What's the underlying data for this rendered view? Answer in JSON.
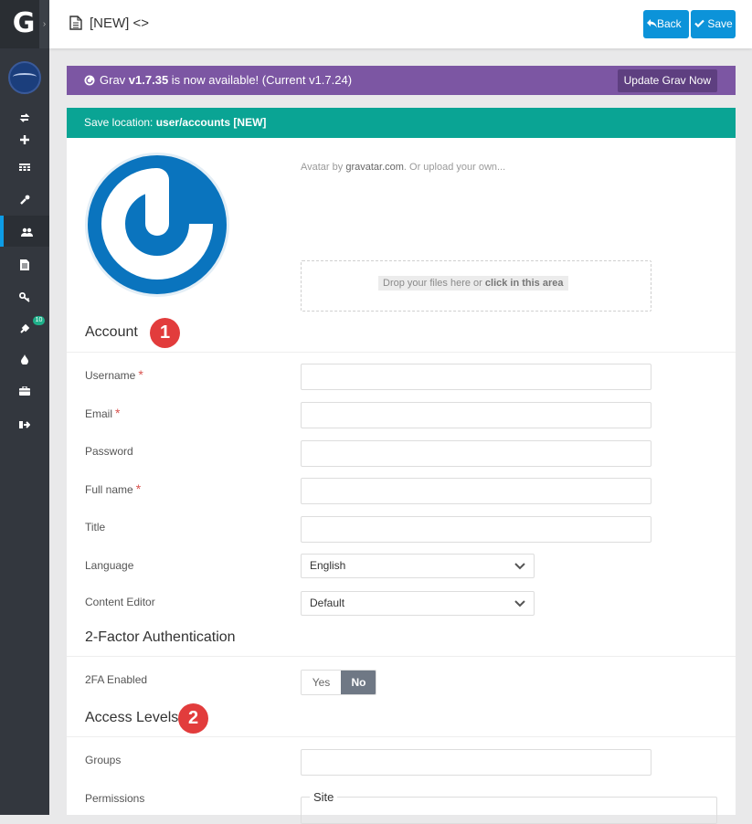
{
  "sidebar": {
    "logo_letter": "G",
    "expand_glyph": "›",
    "items": [
      {
        "icon": "refresh-icon",
        "active": false
      },
      {
        "icon": "plus-icon",
        "active": false
      },
      {
        "icon": "dashboard-icon",
        "active": false
      },
      {
        "icon": "wrench-icon",
        "active": false
      },
      {
        "icon": "users-icon",
        "active": true
      },
      {
        "icon": "pages-icon",
        "active": false
      },
      {
        "icon": "key-icon",
        "active": false
      },
      {
        "icon": "plug-icon",
        "active": false
      },
      {
        "icon": "tint-icon",
        "active": false
      },
      {
        "icon": "briefcase-icon",
        "active": false
      },
      {
        "icon": "sign-out-icon",
        "active": false
      }
    ],
    "plugins_badge": "10"
  },
  "header": {
    "title": "[NEW] <>",
    "back_label": "Back",
    "save_label": "Save"
  },
  "notice": {
    "prefix": "Grav ",
    "version_new": "v1.7.35",
    "middle": " is now available! (Current ",
    "version_current": "v1.7.24",
    "suffix": ")",
    "update_label": "Update Grav Now"
  },
  "save_location": {
    "label": "Save location: ",
    "path": "user/accounts [NEW]"
  },
  "avatar": {
    "note_prefix": "Avatar by ",
    "note_link": "gravatar.com",
    "note_suffix": ". Or upload your own...",
    "drop_text": "Drop your files here or ",
    "drop_link": "click in this area"
  },
  "account": {
    "title": "Account",
    "marker": "1",
    "fields": {
      "username": {
        "label": "Username",
        "required": "*",
        "value": ""
      },
      "email": {
        "label": "Email",
        "required": "*",
        "value": ""
      },
      "password": {
        "label": "Password",
        "value": ""
      },
      "fullname": {
        "label": "Full name",
        "required": "*",
        "value": ""
      },
      "title": {
        "label": "Title",
        "value": ""
      },
      "language": {
        "label": "Language",
        "value": "English"
      },
      "editor": {
        "label": "Content Editor",
        "value": "Default"
      }
    }
  },
  "twofa": {
    "title": "2-Factor Authentication",
    "label": "2FA Enabled",
    "yes": "Yes",
    "no": "No",
    "selected": "No"
  },
  "access": {
    "title": "Access Levels",
    "marker": "2",
    "groups_label": "Groups",
    "groups_value": "",
    "permissions_label": "Permissions",
    "site_legend": "Site"
  },
  "colors": {
    "sidebar": "#33373e",
    "accent": "#0c93d9",
    "notice": "#7c56a3",
    "save_location": "#0aa494",
    "marker": "#e23c3c"
  }
}
